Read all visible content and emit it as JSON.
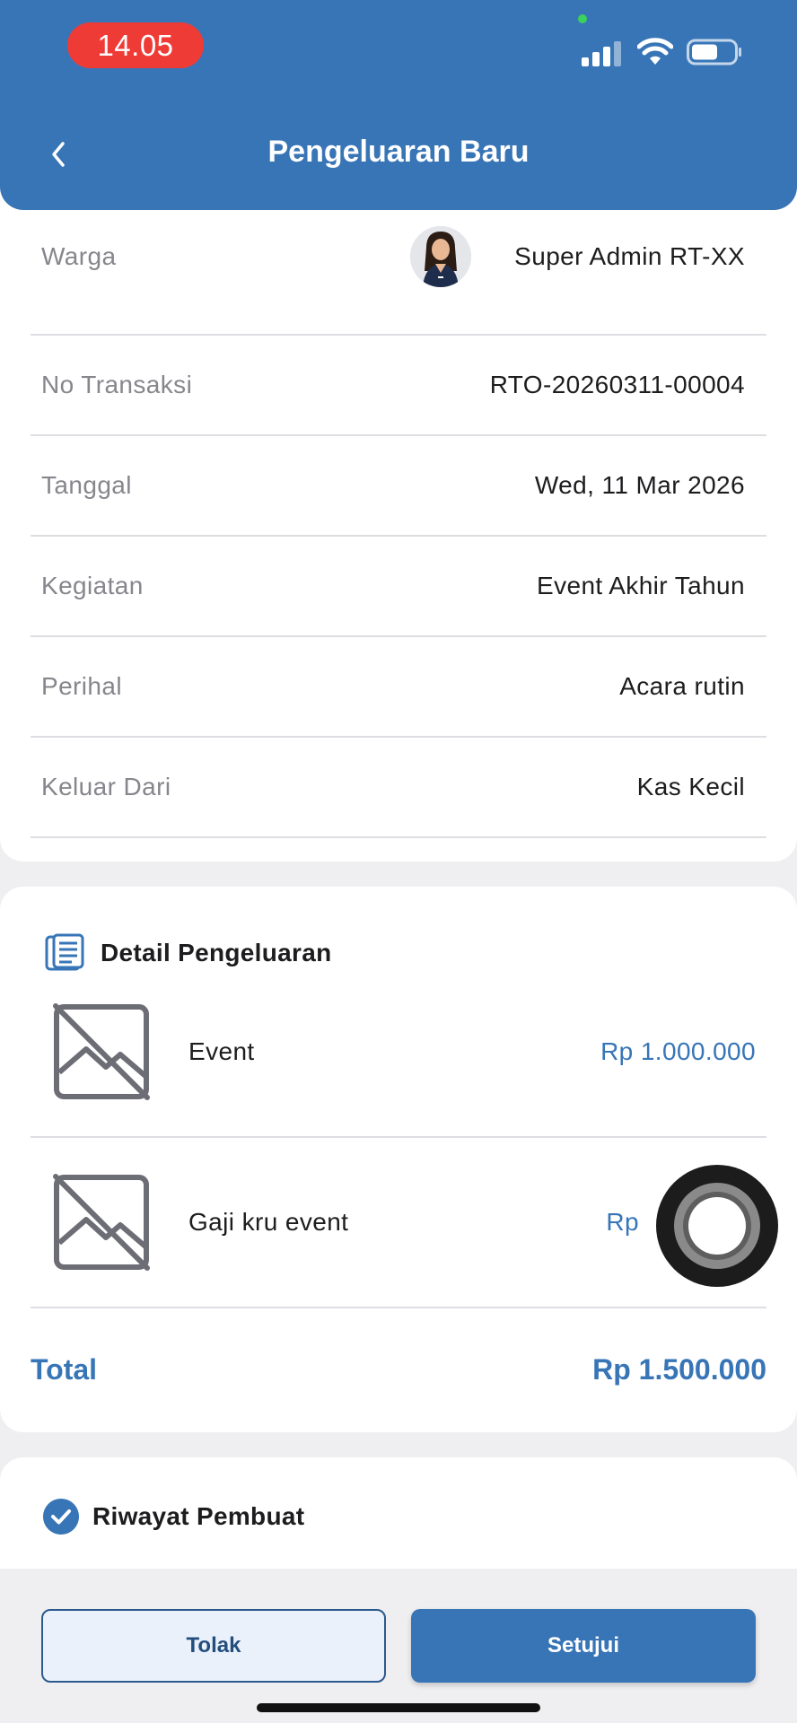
{
  "status_bar": {
    "time": "14.05"
  },
  "header": {
    "title": "Pengeluaran Baru",
    "back_icon": "chevron-left-icon"
  },
  "info": {
    "rows": [
      {
        "label": "Warga",
        "value": "Super Admin RT-XX"
      },
      {
        "label": "No Transaksi",
        "value": "RTO-20260311-00004"
      },
      {
        "label": "Tanggal",
        "value": "Wed, 11 Mar 2026"
      },
      {
        "label": "Kegiatan",
        "value": "Event Akhir Tahun"
      },
      {
        "label": "Perihal",
        "value": "Acara rutin"
      },
      {
        "label": "Keluar Dari",
        "value": "Kas Kecil"
      }
    ]
  },
  "detail": {
    "title": "Detail Pengeluaran",
    "items": [
      {
        "name": "Event",
        "amount": "Rp 1.000.000",
        "image_icon": "broken-image-icon"
      },
      {
        "name": "Gaji kru event",
        "amount": "Rp",
        "image_icon": "broken-image-icon"
      }
    ],
    "total_label": "Total",
    "total_value": "Rp 1.500.000"
  },
  "history": {
    "title": "Riwayat Pembuat"
  },
  "actions": {
    "reject_label": "Tolak",
    "approve_label": "Setujui"
  },
  "colors": {
    "primary": "#3875b7",
    "time_pill": "#ef3b36",
    "background": "#efeff1"
  }
}
